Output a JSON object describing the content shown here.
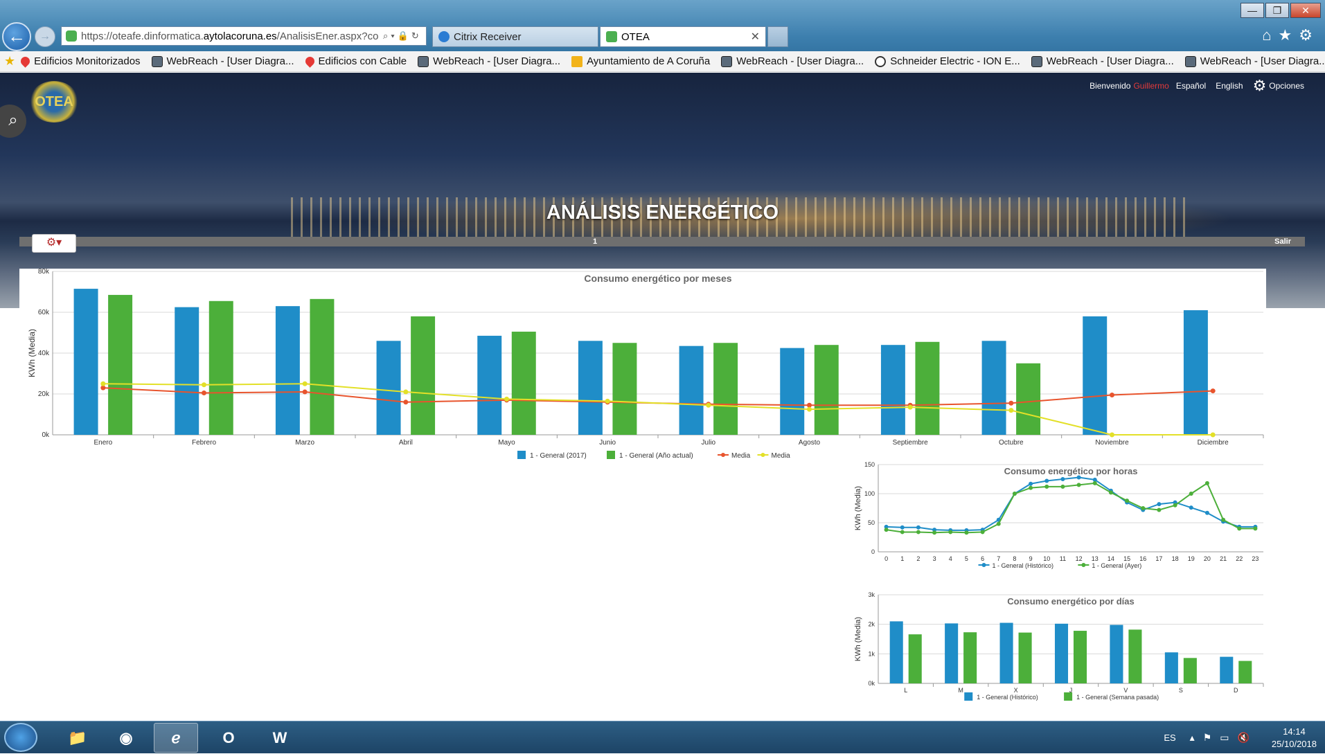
{
  "browser": {
    "url_prefix": "https://oteafe.dinformatica.",
    "url_domain": "aytolacoruna.es",
    "url_path": "/AnalisisEner.aspx?co",
    "tabs": [
      {
        "label": "Citrix Receiver"
      },
      {
        "label": "OTEA"
      }
    ],
    "window_controls": {
      "minimize": "—",
      "restore": "❐",
      "close": "✕"
    }
  },
  "favorites": [
    {
      "label": "Edificios Monitorizados",
      "icon": "pin"
    },
    {
      "label": "WebReach - [User Diagra...",
      "icon": "wr"
    },
    {
      "label": "Edificios con Cable",
      "icon": "pin"
    },
    {
      "label": "WebReach - [User Diagra...",
      "icon": "wr"
    },
    {
      "label": "Ayuntamiento de A Coruña",
      "icon": "ie"
    },
    {
      "label": "WebReach - [User Diagra...",
      "icon": "wr"
    },
    {
      "label": "Schneider Electric - ION E...",
      "icon": "se"
    },
    {
      "label": "WebReach - [User Diagra...",
      "icon": "wr"
    },
    {
      "label": "WebReach - [User Diagra...",
      "icon": "wr"
    }
  ],
  "header": {
    "welcome": "Bienvenido",
    "user": "Guillermo",
    "lang_es": "Español",
    "lang_en": "English",
    "options": "Opciones",
    "logo_text": "OTEA",
    "title": "ANÁLISIS ENERGÉTICO",
    "page_number": "1",
    "logout": "Salir"
  },
  "chart_data": [
    {
      "type": "bar",
      "title": "Consumo energético por meses",
      "ylabel": "KWh (Media)",
      "ylim": [
        0,
        80000
      ],
      "yticks": [
        "0k",
        "20k",
        "40k",
        "60k",
        "80k"
      ],
      "categories": [
        "Enero",
        "Febrero",
        "Marzo",
        "Abril",
        "Mayo",
        "Junio",
        "Julio",
        "Agosto",
        "Septiembre",
        "Octubre",
        "Noviembre",
        "Diciembre"
      ],
      "series": [
        {
          "name": "1 - General (2017)",
          "kind": "bar",
          "color": "#1f8dc8",
          "values": [
            71500,
            62500,
            63000,
            46000,
            48500,
            46000,
            43500,
            42500,
            44000,
            46000,
            58000,
            61000
          ]
        },
        {
          "name": "1 - General (Año actual)",
          "kind": "bar",
          "color": "#4caf3a",
          "values": [
            68500,
            65500,
            66500,
            58000,
            50500,
            45000,
            45000,
            44000,
            45500,
            35000,
            null,
            null
          ]
        },
        {
          "name": "Media",
          "kind": "line",
          "color": "#e8542d",
          "values": [
            23000,
            20500,
            21000,
            16000,
            17000,
            16000,
            15000,
            14500,
            14500,
            15500,
            19500,
            21500
          ]
        },
        {
          "name": "Media",
          "kind": "line",
          "color": "#e3e028",
          "values": [
            25000,
            24500,
            25000,
            21000,
            17500,
            16500,
            14500,
            12500,
            13500,
            12000,
            0,
            0
          ]
        }
      ]
    },
    {
      "type": "line",
      "title": "Consumo energético por horas",
      "ylabel": "KWh (Media)",
      "ylim": [
        0,
        150
      ],
      "yticks": [
        "0",
        "50",
        "100",
        "150"
      ],
      "categories": [
        "0",
        "1",
        "2",
        "3",
        "4",
        "5",
        "6",
        "7",
        "8",
        "9",
        "10",
        "11",
        "12",
        "13",
        "14",
        "15",
        "16",
        "17",
        "18",
        "19",
        "20",
        "21",
        "22",
        "23"
      ],
      "series": [
        {
          "name": "1 - General (Histórico)",
          "color": "#1f8dc8",
          "values": [
            43,
            42,
            42,
            38,
            37,
            37,
            38,
            55,
            100,
            117,
            122,
            125,
            128,
            124,
            105,
            85,
            72,
            82,
            85,
            76,
            67,
            52,
            43,
            43
          ]
        },
        {
          "name": "1 - General (Ayer)",
          "color": "#4caf3a",
          "values": [
            38,
            34,
            34,
            33,
            34,
            33,
            34,
            48,
            100,
            110,
            112,
            112,
            115,
            118,
            102,
            88,
            75,
            72,
            80,
            100,
            118,
            55,
            40,
            40
          ]
        }
      ]
    },
    {
      "type": "bar",
      "title": "Consumo energético por días",
      "ylabel": "KWh (Media)",
      "ylim": [
        0,
        3000
      ],
      "yticks": [
        "0k",
        "1k",
        "2k",
        "3k"
      ],
      "categories": [
        "L",
        "M",
        "X",
        "J",
        "V",
        "S",
        "D"
      ],
      "series": [
        {
          "name": "1 - General (Histórico)",
          "color": "#1f8dc8",
          "values": [
            2100,
            2030,
            2050,
            2020,
            1980,
            1050,
            900
          ]
        },
        {
          "name": "1 - General (Semana pasada)",
          "color": "#4caf3a",
          "values": [
            1660,
            1730,
            1720,
            1780,
            1820,
            860,
            760
          ]
        }
      ]
    }
  ],
  "taskbar": {
    "apps": [
      "start",
      "explorer",
      "chrome",
      "internet-explorer",
      "outlook",
      "word"
    ],
    "outlook_label": "O",
    "word_label": "W",
    "lang": "ES",
    "time": "14:14",
    "date": "25/10/2018"
  }
}
